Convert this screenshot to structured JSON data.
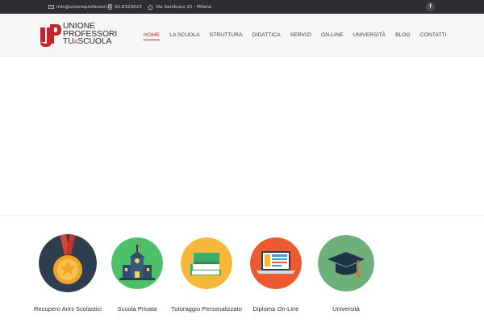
{
  "topbar": {
    "email": "info@unioneprofessori.it",
    "phone": "02.8323023",
    "address": "Via Sambuco 15 - Milano",
    "social_facebook": "f"
  },
  "logo": {
    "line1": "UNIONE",
    "line2": "PROFESSORI",
    "line3_a": "TU",
    "line3_b": "A",
    "line3_c": "SCUOLA"
  },
  "nav": {
    "items": [
      {
        "label": "HOME"
      },
      {
        "label": "LA SCUOLA"
      },
      {
        "label": "STRUTTURA"
      },
      {
        "label": "DIDATTICA"
      },
      {
        "label": "SERVIZI"
      },
      {
        "label": "ON-LINE"
      },
      {
        "label": "UNIVERSITÀ"
      },
      {
        "label": "BLOG"
      },
      {
        "label": "CONTATTI"
      }
    ]
  },
  "services": [
    {
      "label": "Recupero Anni Scolastici",
      "icon": "medal-icon",
      "color": "#2f3e4e"
    },
    {
      "label": "Scuola Privata",
      "icon": "school-building-icon",
      "color": "#4cc16a"
    },
    {
      "label": "Tutoraggio Personalizzato",
      "icon": "books-icon",
      "color": "#f6b83c"
    },
    {
      "label": "Diploma On-Line",
      "icon": "laptop-icon",
      "color": "#ee5a2f"
    },
    {
      "label": "Università",
      "icon": "graduation-cap-icon",
      "color": "#6fb07a"
    }
  ],
  "colors": {
    "accent": "#c0272d",
    "topbar": "#2d2e33"
  }
}
